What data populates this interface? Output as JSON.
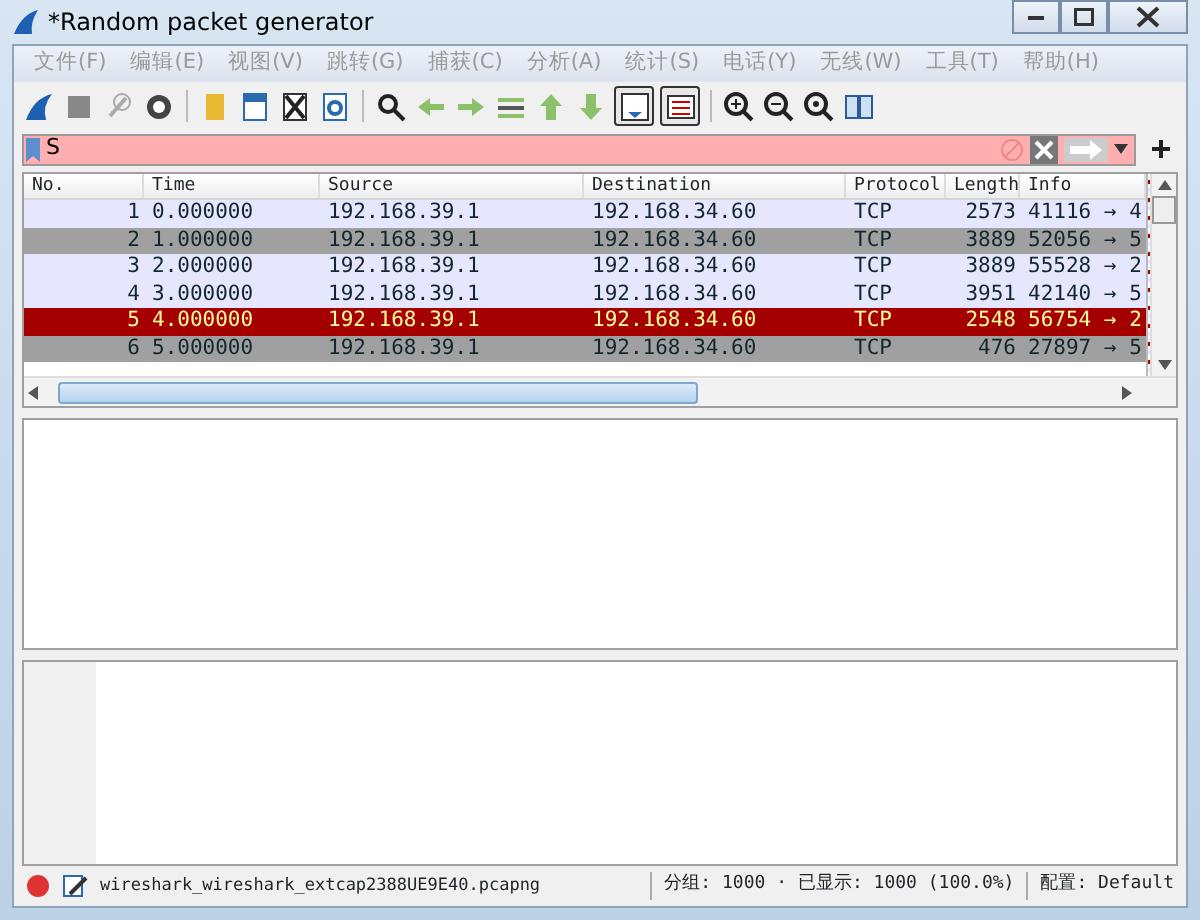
{
  "window": {
    "title": "*Random packet generator"
  },
  "menu": [
    {
      "label": "文件(F)",
      "disabled": true
    },
    {
      "label": "编辑(E)",
      "disabled": true
    },
    {
      "label": "视图(V)",
      "disabled": true
    },
    {
      "label": "跳转(G)",
      "disabled": true
    },
    {
      "label": "捕获(C)",
      "disabled": true
    },
    {
      "label": "分析(A)",
      "disabled": true
    },
    {
      "label": "统计(S)",
      "disabled": true
    },
    {
      "label": "电话(Y)",
      "disabled": true
    },
    {
      "label": "无线(W)",
      "disabled": true
    },
    {
      "label": "工具(T)",
      "disabled": true
    },
    {
      "label": "帮助(H)",
      "disabled": true
    }
  ],
  "filter": {
    "value": "S",
    "valid": false
  },
  "packet_list": {
    "columns": [
      "No.",
      "Time",
      "Source",
      "Destination",
      "Protocol",
      "Length",
      "Info"
    ],
    "rows": [
      {
        "cells": [
          "1",
          "0.000000",
          "192.168.39.1",
          "192.168.34.60",
          "TCP",
          "2573",
          "41116 → 4"
        ],
        "color": "#e7e6ff"
      },
      {
        "cells": [
          "2",
          "1.000000",
          "192.168.39.1",
          "192.168.34.60",
          "TCP",
          "3889",
          "52056 → 5"
        ],
        "color": "#a0a0a0"
      },
      {
        "cells": [
          "3",
          "2.000000",
          "192.168.39.1",
          "192.168.34.60",
          "TCP",
          "3889",
          "55528 → 2"
        ],
        "color": "#e7e6ff"
      },
      {
        "cells": [
          "4",
          "3.000000",
          "192.168.39.1",
          "192.168.34.60",
          "TCP",
          "3951",
          "42140 → 5"
        ],
        "color": "#e7e6ff"
      },
      {
        "cells": [
          "5",
          "4.000000",
          "192.168.39.1",
          "192.168.34.60",
          "TCP",
          "2548",
          "56754 → 2"
        ],
        "color": "#a40000"
      },
      {
        "cells": [
          "6",
          "5.000000",
          "192.168.39.1",
          "192.168.34.60",
          "TCP",
          "476",
          "27897 → 5"
        ],
        "color": "#a0a0a0"
      }
    ]
  },
  "status_bar": {
    "file": "wireshark_wireshark_extcap2388UE9E40.pcapng",
    "packets": "分组: 1000 · 已显示: 1000 (100.0%)",
    "profile": "配置: Default"
  }
}
